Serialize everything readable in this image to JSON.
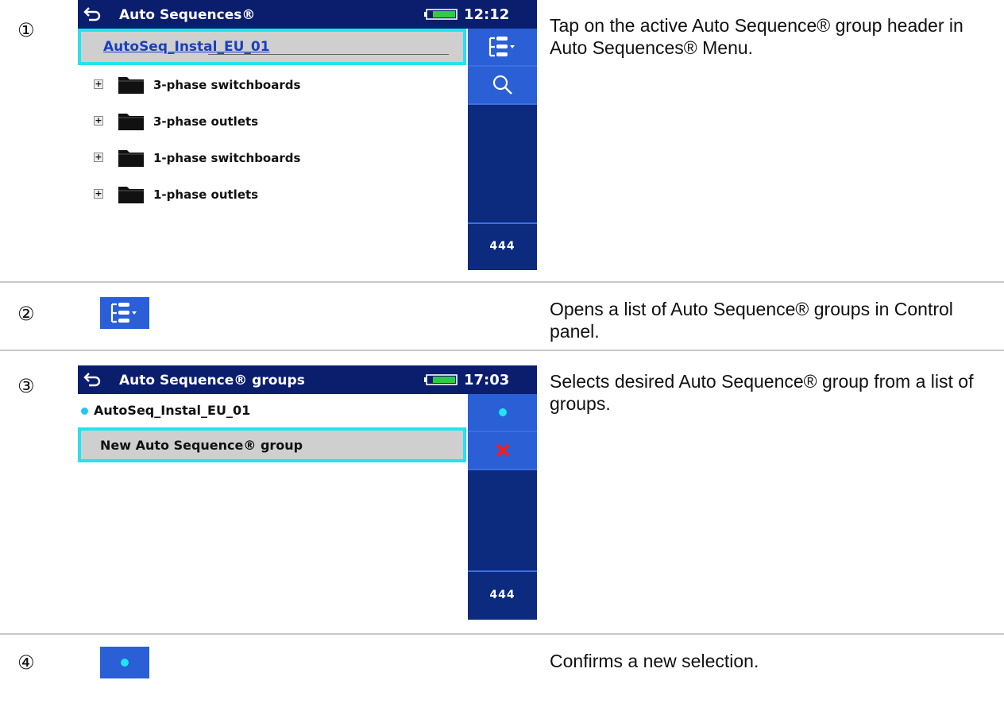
{
  "steps": [
    {
      "num": "①",
      "desc": "Tap on the active Auto Sequence® group header in Auto Sequences® Menu."
    },
    {
      "num": "②",
      "desc": "Opens a list of Auto Sequence® groups in Control panel."
    },
    {
      "num": "③",
      "desc": "Selects desired Auto Sequence® group from a list of groups."
    },
    {
      "num": "④",
      "desc": "Confirms a new selection."
    }
  ],
  "screen1": {
    "title": "Auto Sequences®",
    "time": "12:12",
    "header": "AutoSeq_Instal_EU_01",
    "items": [
      {
        "label": "3-phase switchboards"
      },
      {
        "label": "3-phase outlets"
      },
      {
        "label": "1-phase switchboards"
      },
      {
        "label": "1-phase outlets"
      }
    ],
    "more": "444",
    "icons": [
      "tree-view-dropdown-icon",
      "search-icon"
    ]
  },
  "screen3": {
    "title": "Auto Sequence® groups",
    "time": "17:03",
    "items": [
      {
        "label": "AutoSeq_Instal_EU_01",
        "active": true
      },
      {
        "label": "New Auto Sequence® group",
        "selected": true
      }
    ],
    "more": "444",
    "icons": [
      "select-dot-icon",
      "delete-x-icon"
    ]
  },
  "colors": {
    "titlebar": "#0b1e6e",
    "panel_dark": "#0c2a7e",
    "button": "#2a5fd6",
    "highlight_border": "#22e4ee",
    "selected_bg": "#cfcfcf",
    "link": "#1a3fbf",
    "delete": "#ff1a1a"
  }
}
